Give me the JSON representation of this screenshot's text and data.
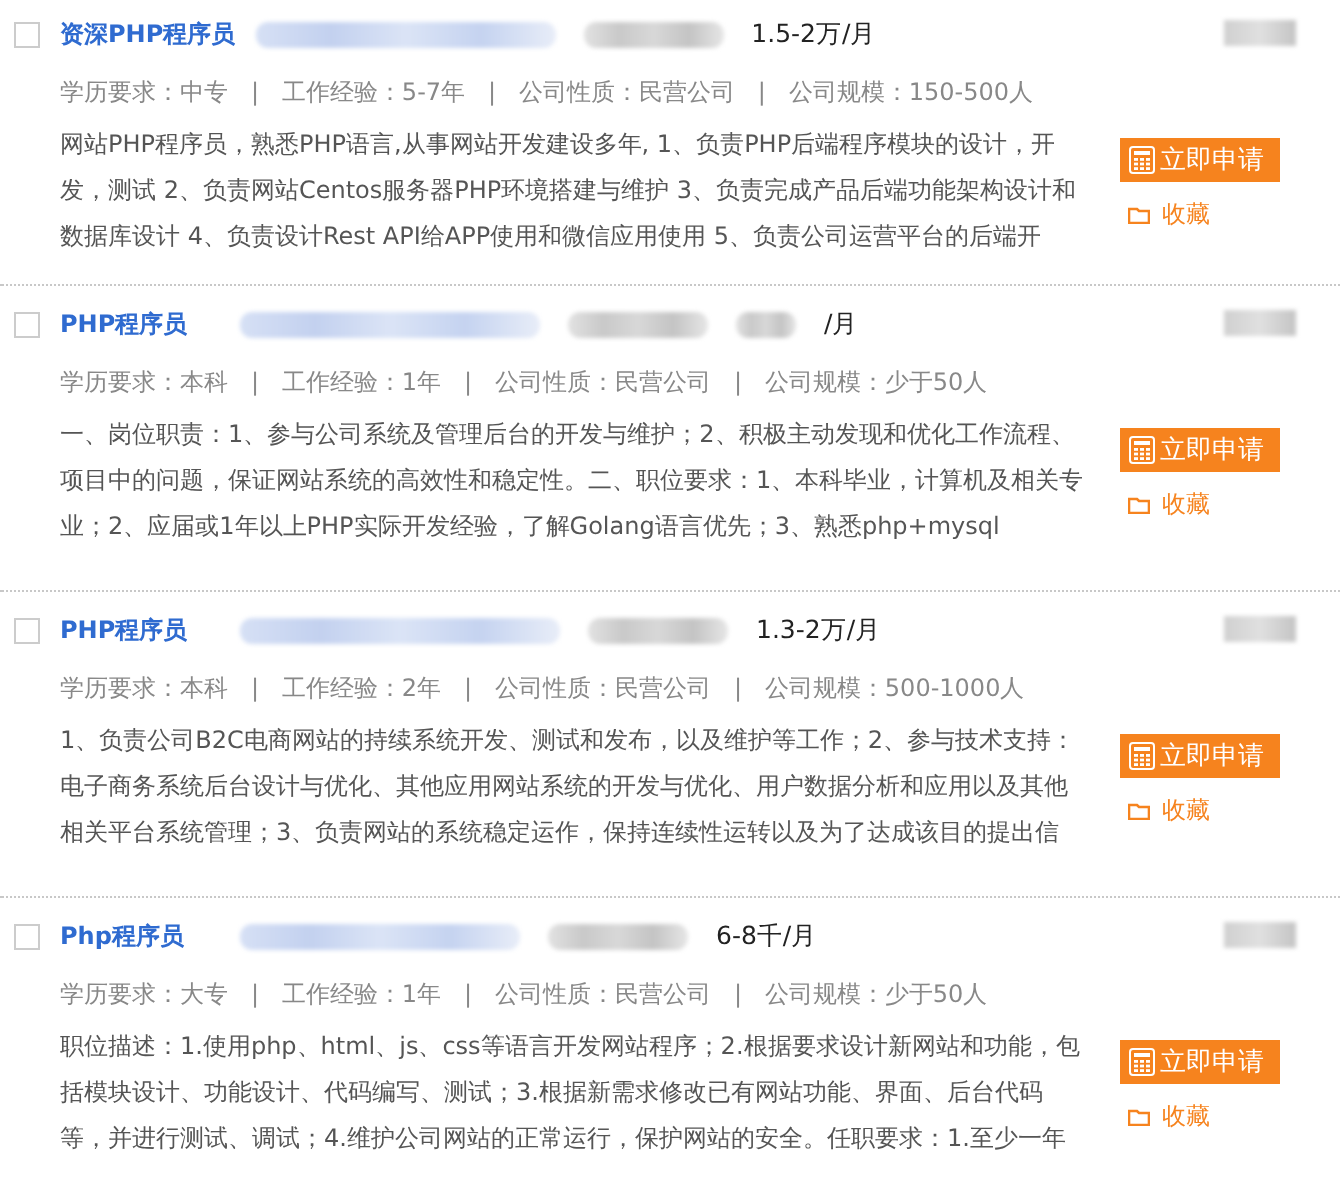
{
  "jobs": [
    {
      "checked": false,
      "title": "资深PHP程序员",
      "salary": "1.5-2万/月",
      "meta": "学历要求：中专   |   工作经验：5-7年   |   公司性质：民营公司   |   公司规模：150-500人",
      "description": "网站PHP程序员，熟悉PHP语言,从事网站开发建设多年, 1、负责PHP后端程序模块的设计，开发，测试 2、负责网站Centos服务器PHP环境搭建与维护 3、负责完成产品后端功能架构设计和数据库设计 4、负责设计Rest API给APP使用和微信应用使用 5、负责公司运营平台的后端开",
      "apply": "立即申请",
      "save": "收藏"
    },
    {
      "checked": false,
      "title": "PHP程序员",
      "salary": "/月",
      "meta": "学历要求：本科   |   工作经验：1年   |   公司性质：民营公司   |   公司规模：少于50人",
      "description": "一、岗位职责：1、参与公司系统及管理后台的开发与维护；2、积极主动发现和优化工作流程、项目中的问题，保证网站系统的高效性和稳定性。二、职位要求：1、本科毕业，计算机及相关专业；2、应届或1年以上PHP实际开发经验，了解Golang语言优先；3、熟悉php+mysql",
      "apply": "立即申请",
      "save": "收藏"
    },
    {
      "checked": false,
      "title": "PHP程序员",
      "salary": "1.3-2万/月",
      "meta": "学历要求：本科   |   工作经验：2年   |   公司性质：民营公司   |   公司规模：500-1000人",
      "description": "1、负责公司B2C电商网站的持续系统开发、测试和发布，以及维护等工作；2、参与技术支持：电子商务系统后台设计与优化、其他应用网站系统的开发与优化、用户数据分析和应用以及其他相关平台系统管理；3、负责网站的系统稳定运作，保持连续性运转以及为了达成该目的提出信",
      "apply": "立即申请",
      "save": "收藏"
    },
    {
      "checked": false,
      "title": "Php程序员",
      "salary": "6-8千/月",
      "meta": "学历要求：大专   |   工作经验：1年   |   公司性质：民营公司   |   公司规模：少于50人",
      "description": "职位描述：1.使用php、html、js、css等语言开发网站程序；2.根据要求设计新网站和功能，包括模块设计、功能设计、代码编写、测试；3.根据新需求修改已有网站功能、界面、后台代码等，并进行测试、调试；4.维护公司网站的正常运行，保护网站的安全。任职要求：1.至少一年",
      "apply": "立即申请",
      "save": "收藏"
    }
  ]
}
